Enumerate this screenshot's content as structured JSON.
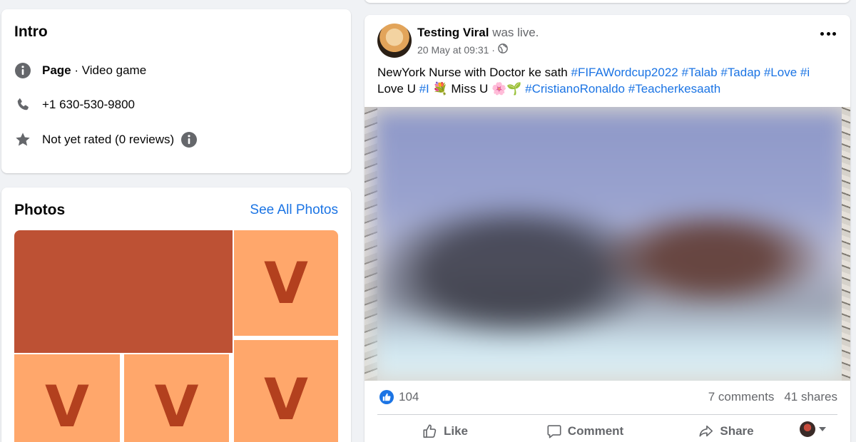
{
  "intro": {
    "title": "Intro",
    "page_label": "Page",
    "category": " · Video game",
    "phone": "+1 630-530-9800",
    "rating": "Not yet rated (0 reviews)"
  },
  "photos": {
    "title": "Photos",
    "see_all": "See All Photos",
    "tiles": [
      "V",
      "V",
      "V",
      "V"
    ]
  },
  "post": {
    "author": "Testing Viral",
    "action": "was live.",
    "timestamp": "20 May at 09:31 ·",
    "text_plain_1": "NewYork Nurse with Doctor ke sath ",
    "tags_1": [
      "#FIFAWordcup2022",
      "#Talab",
      "#Tadap",
      "#Love",
      "#i"
    ],
    "text_plain_2": "Love U ",
    "tag_2": "#I",
    "text_plain_3": " 💐 Miss U 🌸🌱 ",
    "tags_3": [
      "#CristianoRonaldo",
      "#Teacherkesaath"
    ],
    "like_count": "104",
    "comments": "7 comments",
    "shares": "41 shares",
    "actions": {
      "like": "Like",
      "comment": "Comment",
      "share": "Share"
    }
  },
  "colors": {
    "link": "#1b74e4",
    "tile_light": "#ffa76b",
    "tile_dark": "#bd5134",
    "tile_letter": "#b3401e"
  },
  "icons": [
    "info-icon",
    "phone-icon",
    "star-icon",
    "globe-icon",
    "more-icon",
    "like-reaction-icon",
    "like-icon",
    "comment-icon",
    "share-icon",
    "chevron-down-icon"
  ]
}
